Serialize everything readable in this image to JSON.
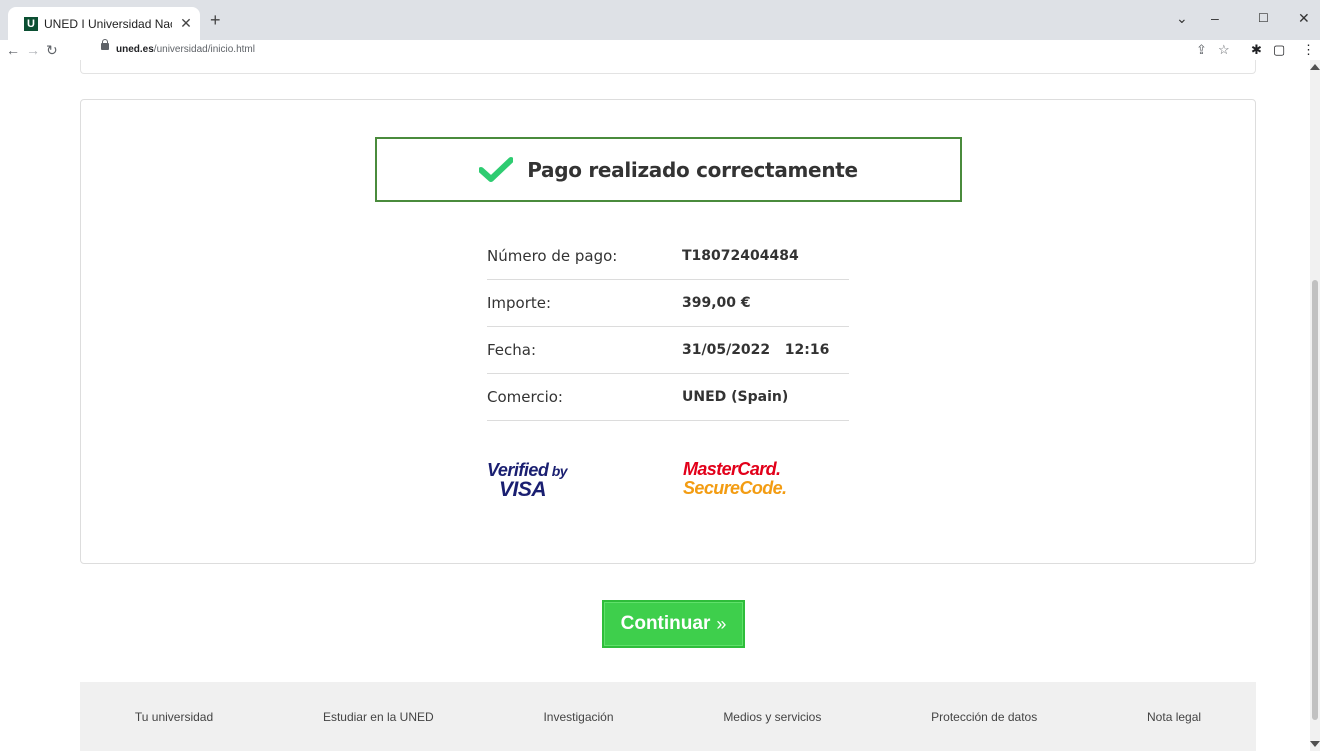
{
  "browser": {
    "tab_title": "UNED I Universidad Nacio",
    "favicon_letter": "U",
    "tab_close": "✕",
    "new_tab": "+",
    "url_host": "uned.es",
    "url_path": "/universidad/inicio.html"
  },
  "payment": {
    "status_text": "Pago realizado correctamente",
    "status_color": "#2ecc71",
    "rows": [
      {
        "label": "Número de pago:",
        "value": "T18072404484"
      },
      {
        "label": "Importe:",
        "value": "399,00 €"
      },
      {
        "label": "Fecha:",
        "value": "31/05/2022   12:16"
      },
      {
        "label": "Comercio:",
        "value": "UNED (Spain)"
      }
    ],
    "visa_line1": "Verified",
    "visa_by": "by",
    "visa_line2": "VISA",
    "mc_line1": "MasterCard.",
    "mc_line2": "SecureCode."
  },
  "continue_button": {
    "label": "Continuar",
    "arrow": "»",
    "color": "#3ecf4c"
  },
  "footer": {
    "links": [
      "Tu universidad",
      "Estudiar en la UNED",
      "Investigación",
      "Medios y servicios",
      "Protección de datos",
      "Nota legal"
    ]
  }
}
